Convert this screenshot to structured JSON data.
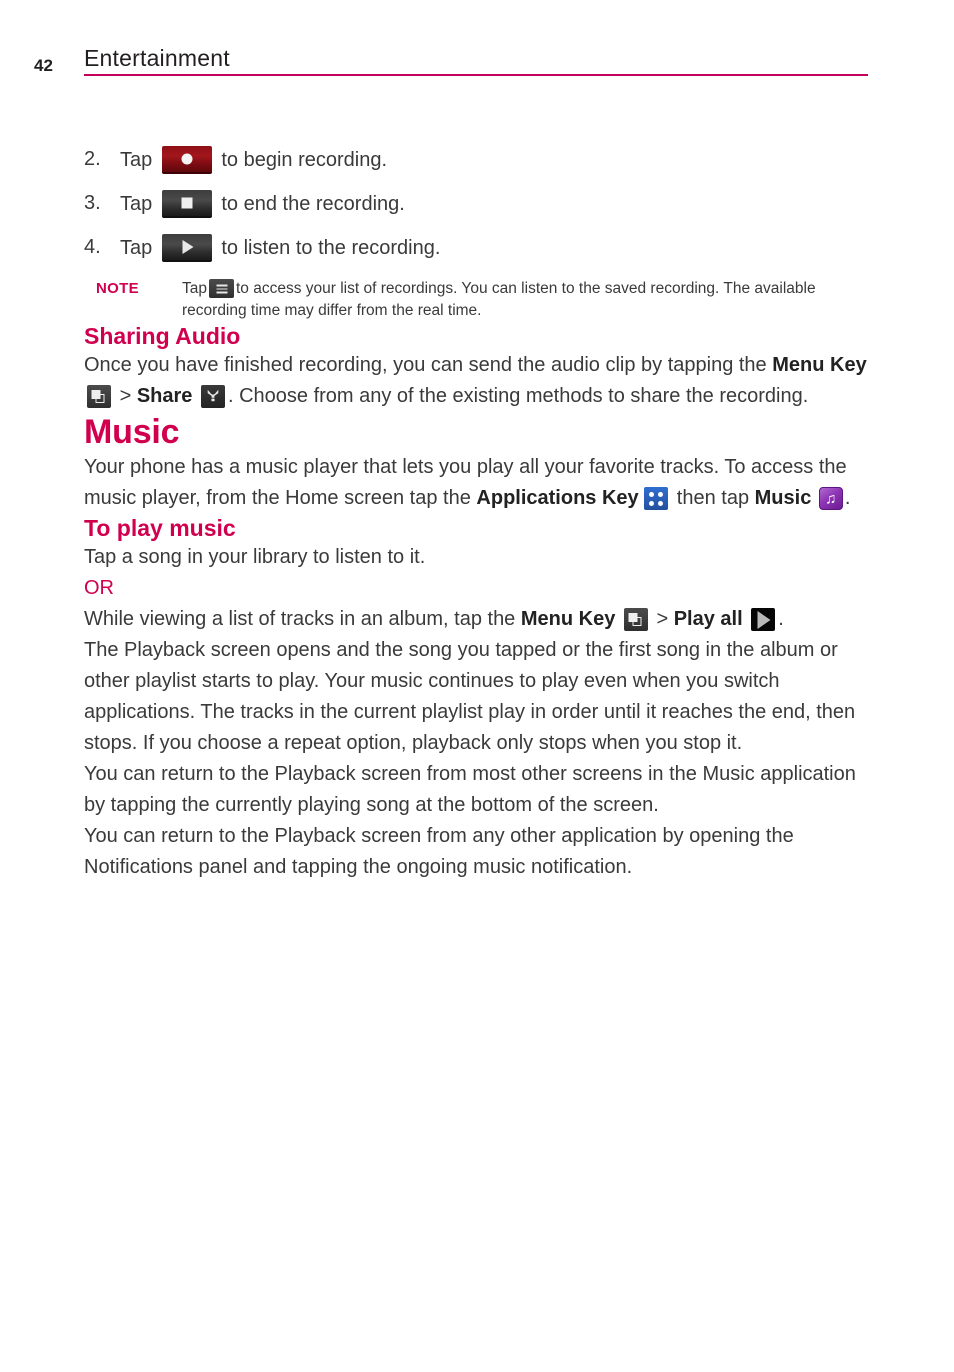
{
  "header": {
    "page_number": "42",
    "title": "Entertainment",
    "rule_color": "#c3005b"
  },
  "colors": {
    "accent": "#d1004f",
    "body_text": "#3a3a3a",
    "heading_text": "#231f20"
  },
  "steps": [
    {
      "number": "2.",
      "before": "Tap",
      "icon": "record-button-icon",
      "after": "to begin recording."
    },
    {
      "number": "3.",
      "before": "Tap",
      "icon": "stop-button-icon",
      "after": "to end the recording."
    },
    {
      "number": "4.",
      "before": "Tap",
      "icon": "play-button-icon",
      "after": "to listen to the recording."
    }
  ],
  "note": {
    "label": "NOTE",
    "before": "Tap",
    "icon": "list-menu-icon",
    "after": "to access your list of recordings. You can listen to the saved recording. The available recording time may differ from the real time."
  },
  "sharing_audio": {
    "heading": "Sharing Audio",
    "p1_part1": "Once you have finished recording, you can send the audio clip by tapping the ",
    "menu_key_label": "Menu Key",
    "menu_key_icon": "menu-key-icon",
    "separator": ">",
    "share_label": "Share",
    "share_icon": "share-icon",
    "p1_part2": ". Choose from any of the existing methods to share the recording."
  },
  "music": {
    "heading": "Music",
    "p1_part1": "Your phone has a music player that lets you play all your favorite tracks. To access the music player, from the Home screen tap the ",
    "applications_key_label": "Applications Key",
    "applications_key_icon": "applications-key-icon",
    "p1_part2": " then tap ",
    "music_label": "Music",
    "music_icon": "music-app-icon",
    "p1_part3": "."
  },
  "to_play_music": {
    "heading": "To play music",
    "p1": "Tap a song in your library to listen to it.",
    "or": "OR",
    "p2_part1": "While viewing a list of tracks in an album, tap the ",
    "menu_key_label": "Menu Key",
    "menu_key_icon": "menu-key-icon",
    "separator": ">",
    "play_all_label": "Play all",
    "play_all_icon": "play-all-icon",
    "p2_part2": ".",
    "p3": "The Playback screen opens and the song you tapped or the first song in the album or other playlist starts to play. Your music continues to play even when you switch applications. The tracks in the current playlist play in order until it reaches the end, then stops. If you choose a repeat option, playback only stops when you stop it.",
    "p4": "You can return to the Playback screen from most other screens in the Music application by tapping the currently playing song at the bottom of the screen.",
    "p5": "You can return to the Playback screen from any other application by opening the Notifications panel and tapping the ongoing music notification."
  }
}
